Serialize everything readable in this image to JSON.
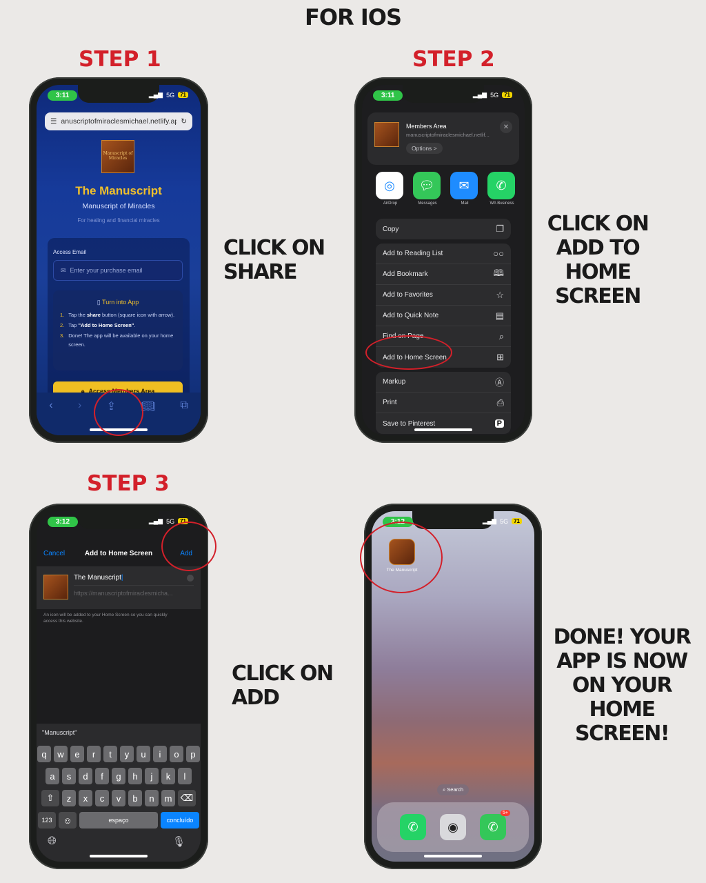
{
  "title": "FOR IOS",
  "steps": [
    {
      "label": "STEP  1",
      "instruction_lines": [
        "CLICK ON",
        "SHARE"
      ]
    },
    {
      "label": "STEP  2",
      "instruction_lines": [
        "CLICK ON",
        "ADD TO",
        "HOME",
        "SCREEN"
      ]
    },
    {
      "label": "STEP  3",
      "instruction_lines": [
        "CLICK ON",
        "ADD"
      ]
    },
    {
      "label": "",
      "instruction_lines": [
        "DONE! YOUR",
        "APP IS NOW",
        "ON YOUR",
        "HOME",
        "SCREEN!"
      ]
    }
  ],
  "colors": {
    "accent_red": "#d3202a",
    "gold": "#f1c02b",
    "ios_blue": "#0a84ff"
  },
  "phone1": {
    "time": "3:11",
    "status": "5G",
    "battery": "71",
    "url": "anuscriptofmiraclesmichael.netlify.app",
    "logo_text": "Manuscript of Miracles",
    "app_title": "The Manuscript",
    "subtitle": "Manuscript of Miracles",
    "tagline": "For healing and financial miracles",
    "email_label": "Access Email",
    "email_placeholder": "Enter your purchase email",
    "turn_title": "Turn into App",
    "steps": [
      {
        "n": "1.",
        "pre": "Tap the ",
        "bold": "share",
        "post": " button (square icon with arrow)."
      },
      {
        "n": "2.",
        "pre": "Tap ",
        "bold": "\"Add to Home Screen\"",
        "post": "."
      },
      {
        "n": "3.",
        "pre": "Done! The app will be available on your home screen.",
        "bold": "",
        "post": ""
      }
    ],
    "cta": "Access Members Area",
    "icons": [
      "back-icon",
      "forward-icon",
      "share-icon",
      "bookmarks-icon",
      "tabs-icon"
    ]
  },
  "phone2": {
    "time": "3:11",
    "status": "5G",
    "battery": "71",
    "site_title": "Members Area",
    "site_url": "manuscriptofmiraclesmichael.netlif...",
    "options": "Options >",
    "apps": [
      {
        "name": "AirDrop",
        "color": "#ffffff",
        "icon": "airdrop-icon"
      },
      {
        "name": "Messages",
        "color": "#34c759",
        "icon": "messages-icon"
      },
      {
        "name": "Mail",
        "color": "#1e8cff",
        "icon": "mail-icon"
      },
      {
        "name": "WA Business",
        "color": "#25d366",
        "icon": "whatsapp-icon"
      }
    ],
    "copy": "Copy",
    "group1": [
      "Add to Reading List",
      "Add Bookmark",
      "Add to Favorites",
      "Add to Quick Note",
      "Find on Page",
      "Add to Home Screen"
    ],
    "group2": [
      "Markup",
      "Print",
      "Save to Pinterest"
    ]
  },
  "phone3": {
    "time": "3:12",
    "status": "5G",
    "battery": "71",
    "cancel": "Cancel",
    "header": "Add to Home Screen",
    "add": "Add",
    "name_value": "The Manuscript",
    "url_value": "https://manuscriptofmiraclesmicha...",
    "note": "An icon will be added to your Home Screen so you can quickly access this website.",
    "suggestion": "\"Manuscript\"",
    "row1": [
      "q",
      "w",
      "e",
      "r",
      "t",
      "y",
      "u",
      "i",
      "o",
      "p"
    ],
    "row2": [
      "a",
      "s",
      "d",
      "f",
      "g",
      "h",
      "j",
      "k",
      "l"
    ],
    "row3": [
      "z",
      "x",
      "c",
      "v",
      "b",
      "n",
      "m"
    ],
    "numkey": "123",
    "space": "espaço",
    "done": "concluído"
  },
  "phone4": {
    "time": "3:12",
    "status": "5G",
    "battery": "71",
    "app_label": "The Manuscript",
    "search": "Search",
    "badge": "5+"
  }
}
